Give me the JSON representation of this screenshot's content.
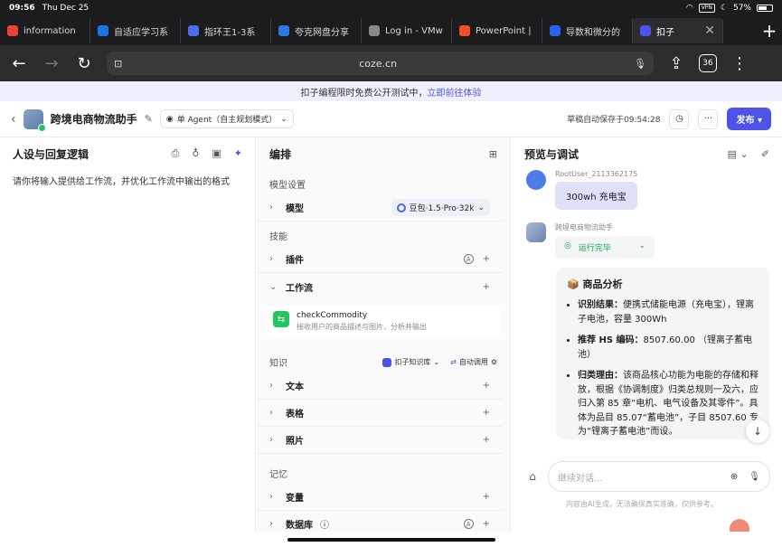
{
  "status": {
    "time": "09:56",
    "date": "Thu Dec 25",
    "vpn": "VPN",
    "battery": "57%"
  },
  "tabs": [
    {
      "label": "information",
      "color": "#ea4335"
    },
    {
      "label": "自适应学习系",
      "color": "#1a73e8"
    },
    {
      "label": "指环王1-3系",
      "color": "#4d6be8"
    },
    {
      "label": "夸克网盘分享",
      "color": "#2a7ae2"
    },
    {
      "label": "Log in - VMw",
      "color": "#888888"
    },
    {
      "label": "PowerPoint |",
      "color": "#f25022"
    },
    {
      "label": "导数和微分的",
      "color": "#2563eb"
    },
    {
      "label": "扣子",
      "color": "#4d53e8",
      "active": true
    }
  ],
  "toolbar": {
    "url": "coze.cn",
    "tab_count": "36"
  },
  "banner": {
    "text": "扣子编程限时免费公开测试中，",
    "link": "立即前往体验"
  },
  "header": {
    "title": "跨境电商物流助手",
    "agent_mode": "单 Agent（自主规划模式）",
    "save_status": "草稿自动保存于09:54:28",
    "publish": "发布"
  },
  "persona": {
    "title": "人设与回复逻辑",
    "prompt": "请你将输入提供给工作流，并优化工作流中输出的格式"
  },
  "arrange": {
    "title": "编排",
    "model_section": "模型设置",
    "model_row": "模型",
    "model_name": "豆包·1.5·Pro·32k",
    "skills_section": "技能",
    "plugins_row": "插件",
    "workflow_row": "工作流",
    "workflow_name": "checkCommodity",
    "workflow_desc": "接收用户的商品描述与图片，分析并输出",
    "knowledge_section": "知识",
    "kb_name": "扣子知识库",
    "kb_auto": "自动调用",
    "text_row": "文本",
    "table_row": "表格",
    "photo_row": "照片",
    "memory_section": "记忆",
    "variable_row": "变量",
    "database_row": "数据库"
  },
  "preview": {
    "title": "预览与调试",
    "user_name": "RootUser_2113362175",
    "user_msg": "300wh 充电宝",
    "bot_name": "跨境电商物流助手",
    "run_status": "运行完毕",
    "answer_title": "商品分析",
    "bullets": [
      {
        "label": "识别结果：",
        "text": "便携式储能电源（充电宝），锂离子电池，容量 300Wh"
      },
      {
        "label": "推荐 HS 编码：",
        "text": "8507.60.00 （锂离子蓄电池）"
      },
      {
        "label": "归类理由：",
        "text": "该商品核心功能为电能的存储和释放，根据《协调制度》归类总规则一及六，应归入第 85 章“电机、电气设备及其零件”。具体为品目 85.07“蓄电池”，子目 8507.60 专为“锂离子蓄电池”而设。"
      }
    ],
    "input_placeholder": "继续对话...",
    "disclaimer": "内容由AI生成，无法确保真实准确，仅供参考。"
  }
}
